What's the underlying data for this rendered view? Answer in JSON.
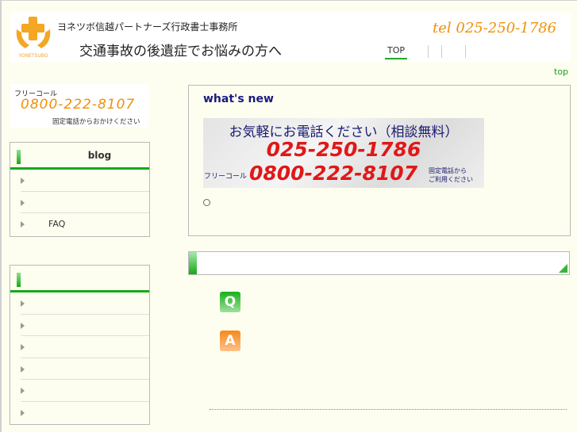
{
  "header": {
    "site_name": "ヨネツボ信越パートナーズ行政書士事務所",
    "tagline": "交通事故の後遺症でお悩みの方へ",
    "tel": "tel 025-250-1786",
    "logo_text": "YONETSUBO",
    "nav": [
      "TOP"
    ]
  },
  "top_link": "top",
  "freecall": {
    "label": "フリーコール",
    "number": "0800-222-8107",
    "note": "固定電話からおかけください"
  },
  "sidebar": {
    "blog_box": {
      "title": "blog",
      "items": [
        "",
        "",
        "FAQ"
      ]
    },
    "second_box": {
      "title": "",
      "items": [
        "",
        "",
        "",
        "",
        "",
        ""
      ]
    }
  },
  "main": {
    "heading": "what's new",
    "banner": {
      "line1": "お気軽にお電話ください（相談無料）",
      "tel": "025-250-1786",
      "free_label": "フリーコール",
      "free_number": "0800-222-8107",
      "free_note1": "固定電話から",
      "free_note2": "ご利用ください"
    }
  },
  "qa": {
    "q_label": "Q",
    "a_label": "A"
  },
  "colors": {
    "accent": "#18a818",
    "orange": "#f0900a",
    "bg": "#fefef0"
  }
}
